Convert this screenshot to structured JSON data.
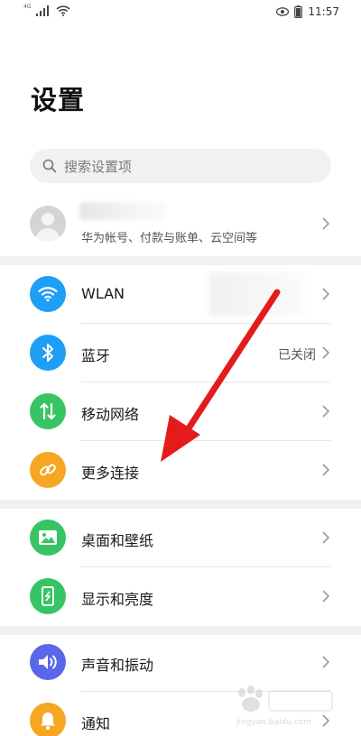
{
  "status_bar": {
    "network_label": "4G",
    "time": "11:57"
  },
  "page": {
    "title": "设置"
  },
  "search": {
    "placeholder": "搜索设置项"
  },
  "account": {
    "subtitle": "华为帐号、付款与账单、云空间等"
  },
  "sections": [
    {
      "items": [
        {
          "label": "WLAN",
          "value": "",
          "icon": "wifi-icon",
          "color": "#1e9ef4"
        },
        {
          "label": "蓝牙",
          "value": "已关闭",
          "icon": "bluetooth-icon",
          "color": "#1e9ef4"
        },
        {
          "label": "移动网络",
          "value": "",
          "icon": "mobile-data-icon",
          "color": "#37c463"
        },
        {
          "label": "更多连接",
          "value": "",
          "icon": "link-icon",
          "color": "#f5a623"
        }
      ]
    },
    {
      "items": [
        {
          "label": "桌面和壁纸",
          "value": "",
          "icon": "wallpaper-icon",
          "color": "#37c463"
        },
        {
          "label": "显示和亮度",
          "value": "",
          "icon": "display-icon",
          "color": "#37c463"
        }
      ]
    },
    {
      "items": [
        {
          "label": "声音和振动",
          "value": "",
          "icon": "sound-icon",
          "color": "#5a67e8"
        },
        {
          "label": "通知",
          "value": "",
          "icon": "notification-icon",
          "color": "#f5a623"
        }
      ]
    }
  ],
  "annotation": {
    "arrow_color": "#e31b1b"
  },
  "watermark": {
    "text": "jingyan.baidu.com"
  }
}
